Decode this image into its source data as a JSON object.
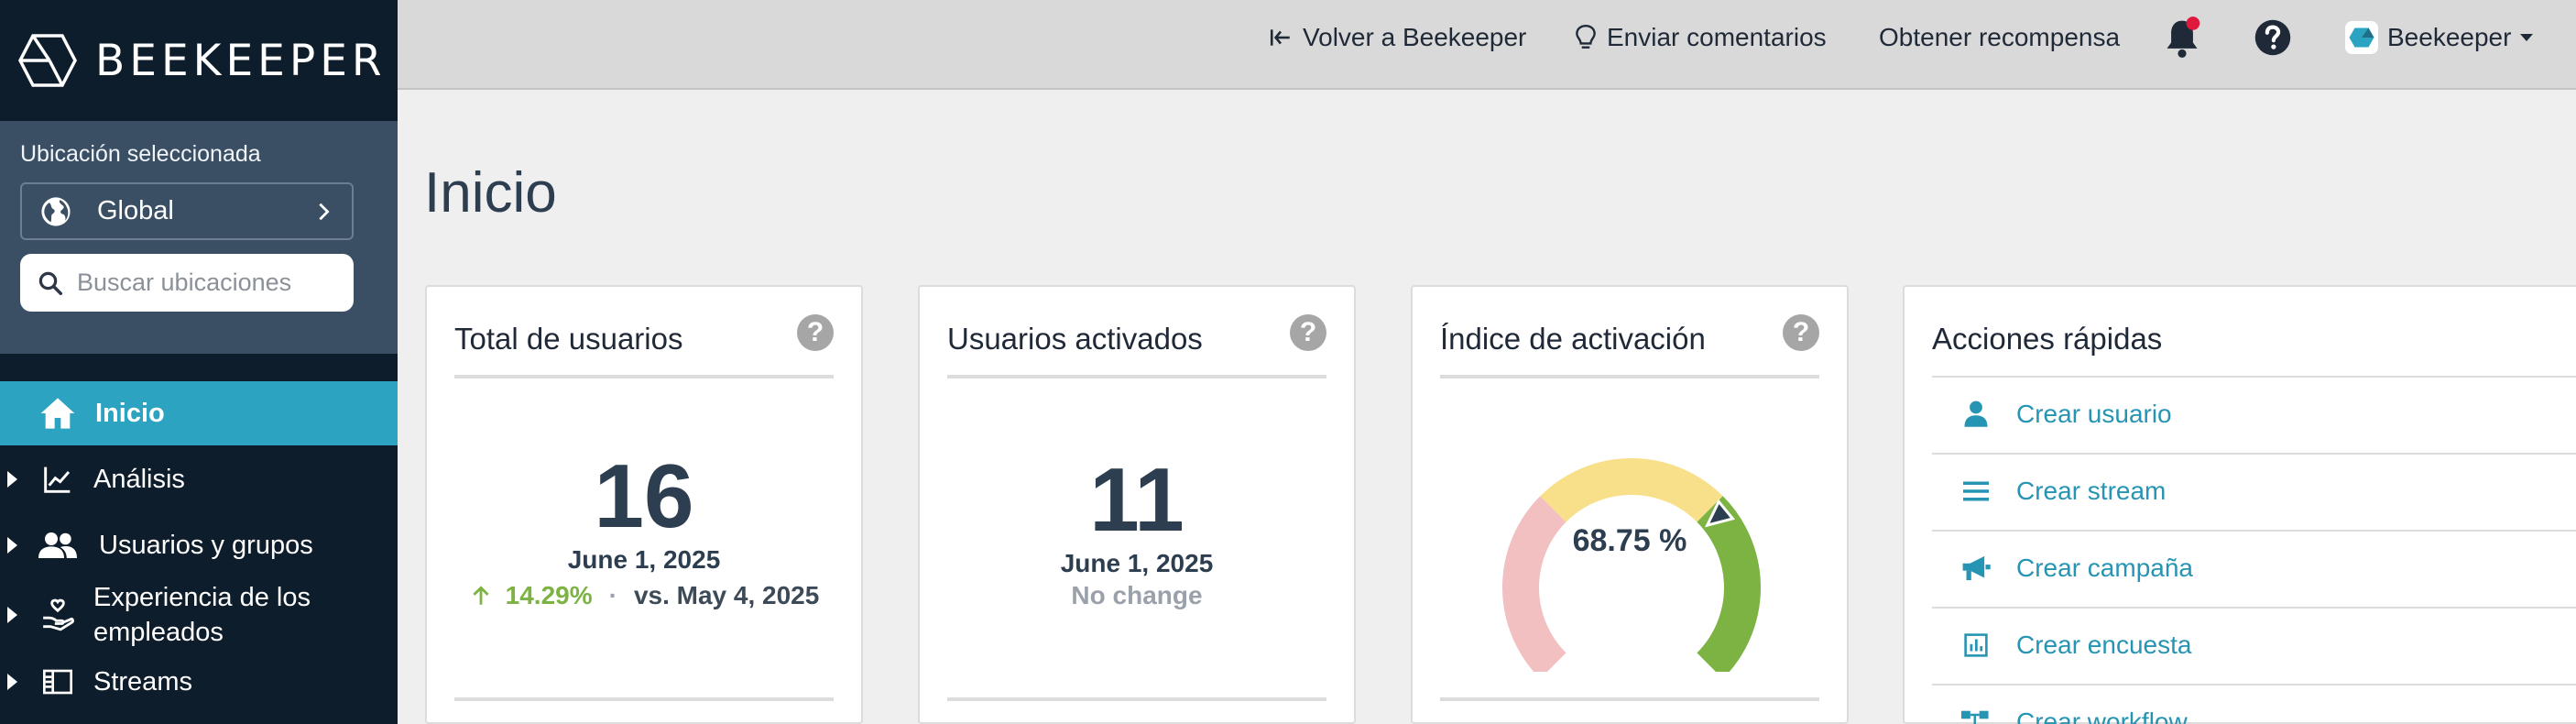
{
  "app": {
    "logo_text": "BEEKEEPER"
  },
  "sidebar": {
    "location_label": "Ubicación seleccionada",
    "location_value": "Global",
    "search_placeholder": "Buscar ubicaciones",
    "nav": [
      {
        "label": "Inicio",
        "icon": "home-icon",
        "active": true,
        "expandable": false
      },
      {
        "label": "Análisis",
        "icon": "chart-line-icon",
        "active": false,
        "expandable": true
      },
      {
        "label": "Usuarios y grupos",
        "icon": "users-icon",
        "active": false,
        "expandable": true
      },
      {
        "label": "Experiencia de los empleados",
        "icon": "hand-heart-icon",
        "active": false,
        "expandable": true
      },
      {
        "label": "Streams",
        "icon": "streams-icon",
        "active": false,
        "expandable": true
      }
    ]
  },
  "topbar": {
    "back_label": "Volver a Beekeeper",
    "feedback_label": "Enviar comentarios",
    "reward_label": "Obtener recompensa",
    "account_label": "Beekeeper"
  },
  "page": {
    "title": "Inicio"
  },
  "cards": {
    "total_users": {
      "title": "Total de usuarios",
      "value": "16",
      "date": "June 1, 2025",
      "change": "14.29%",
      "separator": "·",
      "compare": "vs. May 4, 2025"
    },
    "activated_users": {
      "title": "Usuarios activados",
      "value": "11",
      "date": "June 1, 2025",
      "change": "No change"
    },
    "activation_rate": {
      "title": "Índice de activación",
      "value_label": "68.75 %",
      "value": 68.75,
      "segment_colors": [
        "#f2c0c1",
        "#f8e08a",
        "#7cb342"
      ]
    }
  },
  "quick_actions": {
    "title": "Acciones rápidas",
    "items": [
      {
        "label": "Crear usuario",
        "icon": "user-icon"
      },
      {
        "label": "Crear stream",
        "icon": "list-icon"
      },
      {
        "label": "Crear campaña",
        "icon": "megaphone-icon"
      },
      {
        "label": "Crear encuesta",
        "icon": "poll-icon"
      },
      {
        "label": "Crear workflow",
        "icon": "workflow-icon"
      }
    ]
  },
  "colors": {
    "sidebar_bg": "#0e1d2b",
    "active_nav": "#2ba3c1",
    "link": "#2694b3",
    "positive": "#7cb342",
    "notification_dot": "#e0183b"
  }
}
